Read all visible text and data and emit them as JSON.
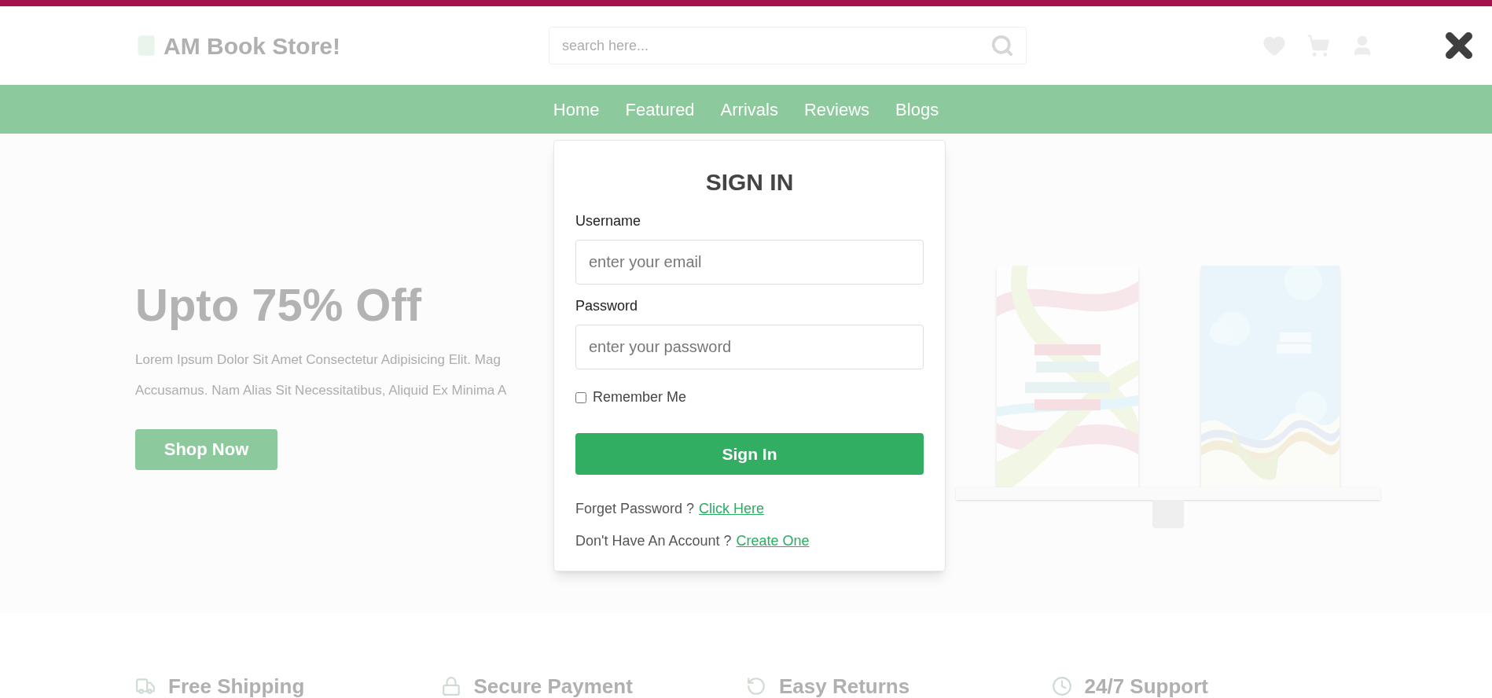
{
  "logo": {
    "text": "AM Book Store!"
  },
  "search": {
    "placeholder": "search here..."
  },
  "nav": {
    "links": [
      "Home",
      "Featured",
      "Arrivals",
      "Reviews",
      "Blogs"
    ]
  },
  "hero": {
    "title": "Upto 75% Off",
    "description": [
      "Lorem Ipsum Dolor Sit Amet Consectetur Adipisicing Elit. Mag",
      "Accusamus. Nam Alias Sit Necessitatibus, Aliquid Ex Minima A"
    ],
    "button": "Shop Now"
  },
  "modal": {
    "title": "SIGN IN",
    "fields": [
      {
        "label": "Username",
        "placeholder": "enter your email"
      },
      {
        "label": "Password",
        "placeholder": "enter your password"
      }
    ],
    "remember": {
      "label": "Remember Me",
      "checked": false
    },
    "submit": "Sign In",
    "links": [
      {
        "text": "Forget Password ?",
        "link": "Click Here"
      },
      {
        "text": "Don't Have An Account ?",
        "link": "Create One"
      }
    ]
  },
  "features": [
    {
      "kind": "shipping",
      "title": "Free Shipping"
    },
    {
      "kind": "payment",
      "title": "Secure Payment"
    },
    {
      "kind": "returns",
      "title": "Easy Returns"
    },
    {
      "kind": "support",
      "title": "24/7 Support"
    }
  ]
}
